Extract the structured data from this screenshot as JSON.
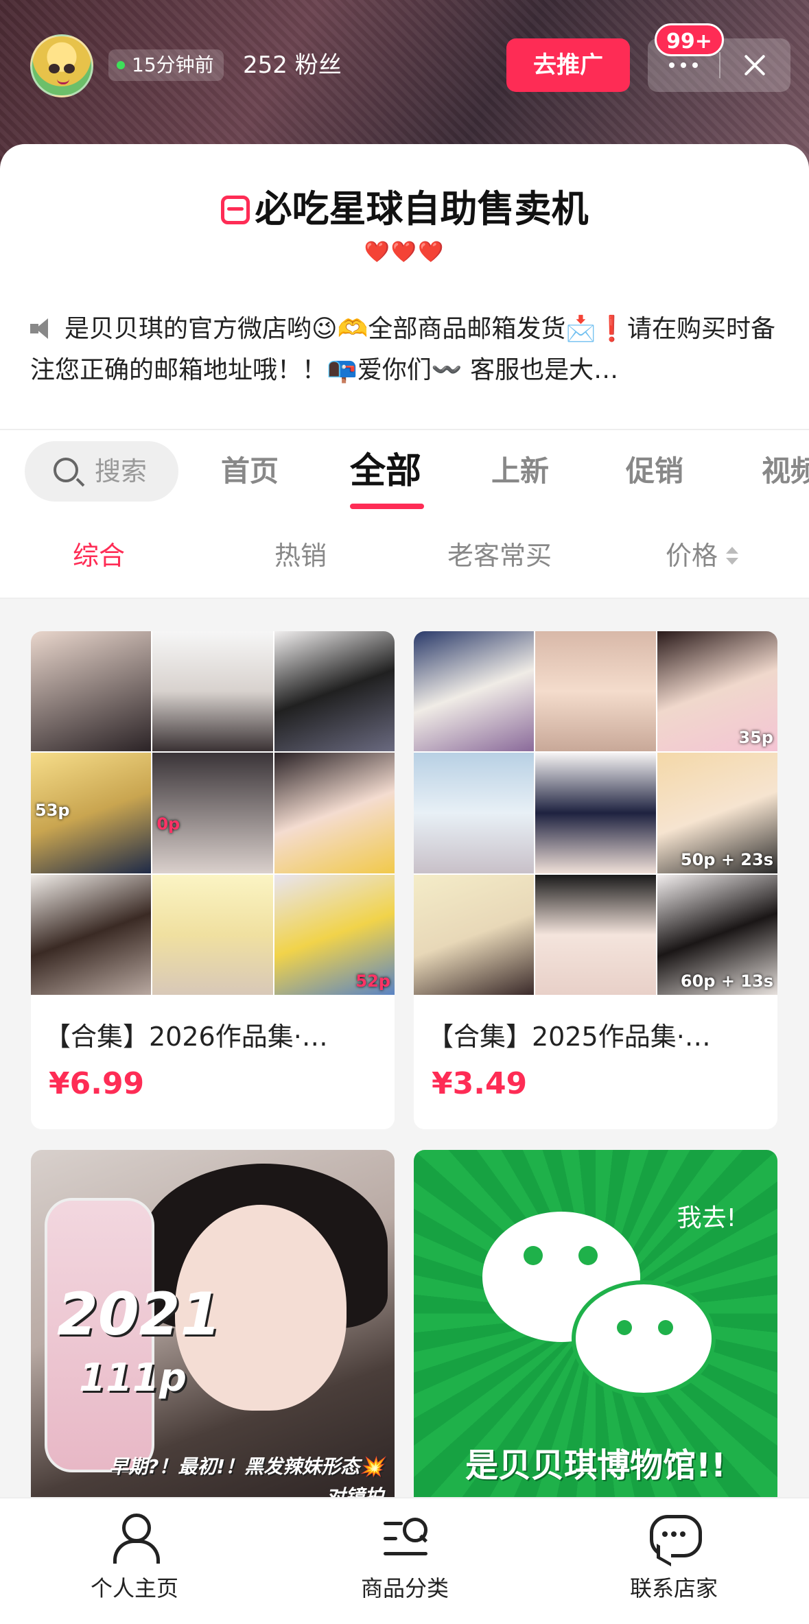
{
  "header": {
    "online_status": "15分钟前",
    "fans": "252 粉丝",
    "promote_label": "去推广",
    "notification_badge": "99+"
  },
  "store": {
    "name": "必吃星球自助售卖机",
    "hearts": "❤️❤️❤️",
    "announcement": "是贝贝琪的官方微店哟😉🫶全部商品邮箱发货📩❗️请在购买时备注您正确的邮箱地址哦！！📭爱你们〰️ 客服也是大…"
  },
  "search": {
    "placeholder": "搜索"
  },
  "tabs": [
    {
      "label": "首页"
    },
    {
      "label": "全部",
      "active": true
    },
    {
      "label": "上新"
    },
    {
      "label": "促销"
    },
    {
      "label": "视频"
    }
  ],
  "sort": [
    {
      "label": "综合",
      "active": true
    },
    {
      "label": "热销"
    },
    {
      "label": "老客常买"
    },
    {
      "label": "价格"
    }
  ],
  "products": [
    {
      "title": "【合集】2026作品集·…",
      "price": "¥6.99",
      "tags": [
        "53p",
        "0p",
        "52p"
      ]
    },
    {
      "title": "【合集】2025作品集·…",
      "price": "¥3.49",
      "tags": [
        "35p",
        "50p + 23s",
        "60p + 13s"
      ]
    },
    {
      "image_text": {
        "year": "2021",
        "count": "111p",
        "caption": "早期?！最初!！黑发辣妹形态💥对镜拍"
      }
    },
    {
      "image_text": {
        "top": "我去!",
        "bottom": "是贝贝琪博物馆!!"
      }
    }
  ],
  "bottom_nav": [
    {
      "label": "个人主页"
    },
    {
      "label": "商品分类"
    },
    {
      "label": "联系店家"
    }
  ],
  "colors": {
    "accent": "#fe2c55",
    "wechat_green": "#1fb14a"
  }
}
